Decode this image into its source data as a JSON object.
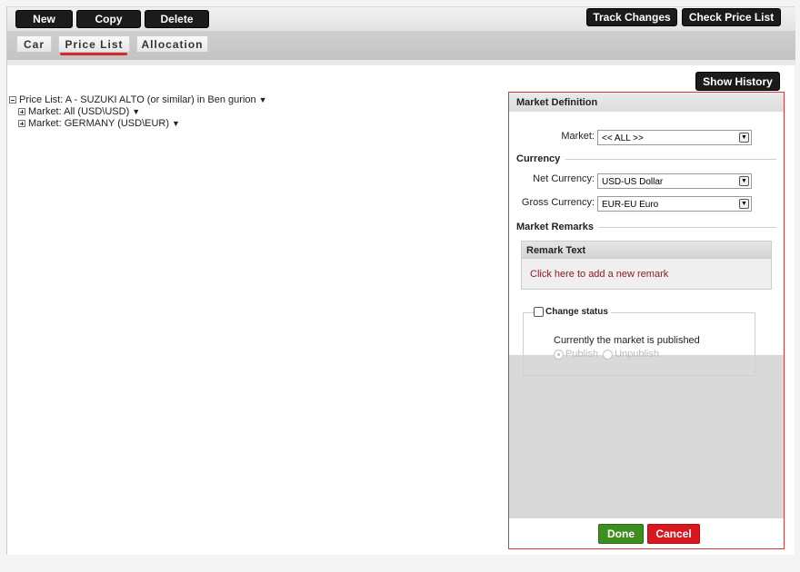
{
  "toolbar": {
    "new_label": "New",
    "copy_label": "Copy",
    "delete_label": "Delete",
    "track_changes_label": "Track Changes",
    "check_price_list_label": "Check Price List"
  },
  "tabs": [
    {
      "label": "Car",
      "active": false
    },
    {
      "label": "Price List",
      "active": true
    },
    {
      "label": "Allocation",
      "active": false
    }
  ],
  "show_history_label": "Show History",
  "tree": {
    "root": "Price List: A - SUZUKI ALTO (or similar) in Ben gurion",
    "children": [
      "Market: All (USD\\USD)",
      "Market: GERMANY (USD\\EUR)"
    ],
    "caret": "▼"
  },
  "panel": {
    "title": "Market Definition",
    "market_label": "Market:",
    "market_value": "<< ALL >>",
    "currency_section": "Currency",
    "net_currency_label": "Net Currency:",
    "net_currency_value": "USD-US Dollar",
    "gross_currency_label": "Gross Currency:",
    "gross_currency_value": "EUR-EU Euro",
    "remarks_section": "Market Remarks",
    "remark_header": "Remark Text",
    "remark_link": "Click here to add a new remark",
    "change_status_label": "Change status",
    "status_text": "Currently the market is published",
    "publish_label": "Publish",
    "unpublish_label": "Unpublish",
    "done_label": "Done",
    "cancel_label": "Cancel"
  },
  "colors": {
    "accent_red": "#d32a2a",
    "done_green": "#3d8f1f",
    "cancel_red": "#d8171f",
    "button_dark": "#1b1b1b"
  }
}
